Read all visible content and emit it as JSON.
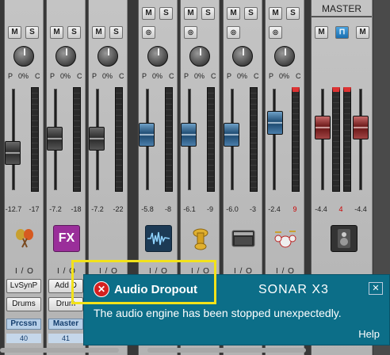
{
  "master": {
    "header": "MASTER",
    "values": [
      "-4.4",
      "4",
      "-4.4"
    ]
  },
  "strips": [
    {
      "pan": [
        "P",
        "0%",
        "C"
      ],
      "values": [
        "-12.7",
        "-17"
      ],
      "io": "I / O",
      "chips": [
        "LvSynP",
        "Drums"
      ],
      "name": "Prcssn",
      "num": "40",
      "icon": "maracas-icon"
    },
    {
      "pan": [
        "P",
        "0%",
        "C"
      ],
      "values": [
        "-7.2",
        "-18"
      ],
      "io": "I / O",
      "chips": [
        "Add D",
        "Drum"
      ],
      "name": "Master",
      "num": "41",
      "icon": "fx-icon",
      "fx": "FX"
    },
    {
      "pan": [
        "P",
        "0%",
        "C"
      ],
      "values": [
        "-7.2",
        "-22"
      ],
      "io": "I / O"
    },
    {
      "pan": [
        "P",
        "0%",
        "C"
      ],
      "values": [
        "-5.8",
        "-8"
      ],
      "io": "I / O",
      "icon": "waveform-icon"
    },
    {
      "pan": [
        "P",
        "0%",
        "C"
      ],
      "values": [
        "-6.1",
        "-9"
      ],
      "io": "I / O",
      "icon": "tuba-icon"
    },
    {
      "pan": [
        "P",
        "0%",
        "C"
      ],
      "values": [
        "-6.0",
        "-3"
      ],
      "io": "I / O",
      "icon": "amplifier-icon"
    },
    {
      "pan": [
        "P",
        "0%",
        "C"
      ],
      "values": [
        "-2.4",
        "9"
      ],
      "io": "I / O",
      "icon": "drumkit-icon"
    }
  ],
  "buttons": {
    "mute": "M",
    "solo": "S"
  },
  "toast": {
    "title": "Audio Dropout",
    "brand": "SONAR X3",
    "message": "The audio engine has been stopped unexpectedly.",
    "help": "Help",
    "close": "✕",
    "error_glyph": "✕"
  },
  "colors": {
    "toast_bg": "#0c6e88",
    "highlight": "#f2e21a",
    "error": "#d42020"
  }
}
